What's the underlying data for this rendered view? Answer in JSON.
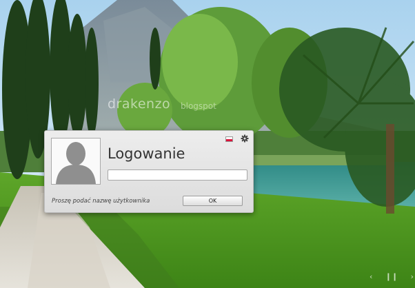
{
  "background": {
    "watermark_main": "drakenzo",
    "watermark_suffix": "blogspot"
  },
  "login": {
    "title": "Logowanie",
    "username_value": "",
    "prompt": "Proszę podać nazwę użytkownika",
    "ok_label": "OK"
  },
  "header_icons": {
    "language": "polish-flag-icon",
    "settings": "gear-icon"
  },
  "colors": {
    "dialog_bg": "#e6e6e6",
    "flag_white": "#ffffff",
    "flag_red": "#dc143c"
  }
}
